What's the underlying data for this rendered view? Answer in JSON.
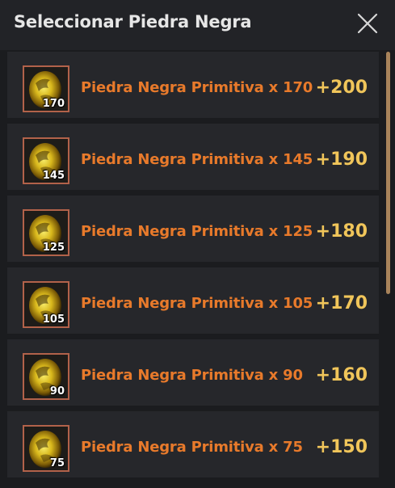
{
  "dialog": {
    "title": "Seleccionar Piedra Negra",
    "close_icon": "close-icon"
  },
  "items": [
    {
      "quantity": "170",
      "name": "Piedra Negra Primitiva x 170",
      "value": "+200"
    },
    {
      "quantity": "145",
      "name": "Piedra Negra Primitiva x 145",
      "value": "+190"
    },
    {
      "quantity": "125",
      "name": "Piedra Negra Primitiva x 125",
      "value": "+180"
    },
    {
      "quantity": "105",
      "name": "Piedra Negra Primitiva x 105",
      "value": "+170"
    },
    {
      "quantity": "90",
      "name": "Piedra Negra Primitiva x 90",
      "value": "+160"
    },
    {
      "quantity": "75",
      "name": "Piedra Negra Primitiva x 75",
      "value": "+150"
    }
  ],
  "colors": {
    "item_name": "#e87a2b",
    "item_value": "#f0c55a",
    "icon_border": "#b2624a",
    "scrollbar": "#a8835a"
  },
  "icons": {
    "item": "black-stone-icon"
  }
}
